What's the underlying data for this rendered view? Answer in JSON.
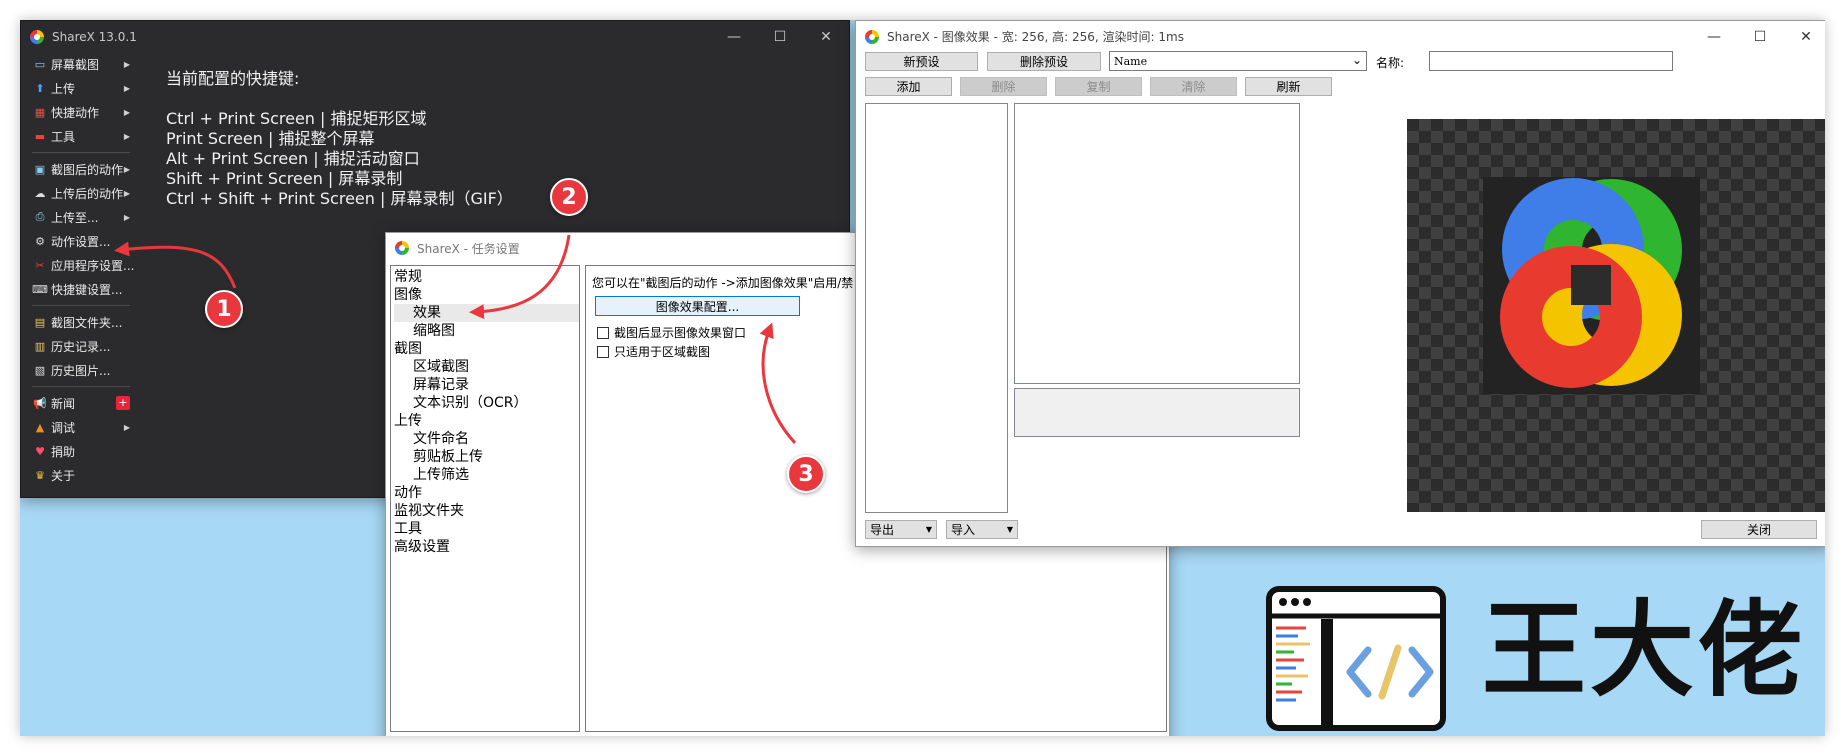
{
  "main_window": {
    "title": "ShareX 13.0.1",
    "menu": [
      {
        "label": "屏幕截图",
        "icon": "monitor-icon",
        "glyph": "▭",
        "color": "#8ecbf0",
        "arrow": true
      },
      {
        "label": "上传",
        "icon": "upload-arrow-icon",
        "glyph": "⬆",
        "color": "#4aa3ff",
        "arrow": true
      },
      {
        "label": "快捷动作",
        "icon": "grid-icon",
        "glyph": "▦",
        "color": "#e0504a",
        "arrow": true
      },
      {
        "label": "工具",
        "icon": "toolbox-icon",
        "glyph": "▬",
        "color": "#e8433c",
        "arrow": true
      },
      {
        "label": "截图后的动作",
        "icon": "image-icon",
        "glyph": "▣",
        "color": "#8ecbf0",
        "arrow": true
      },
      {
        "label": "上传后的动作",
        "icon": "cloud-upload-icon",
        "glyph": "☁",
        "color": "#dddddd",
        "arrow": true
      },
      {
        "label": "上传至...",
        "icon": "printer-icon",
        "glyph": "⎙",
        "color": "#8ecbf0",
        "arrow": true
      },
      {
        "label": "动作设置...",
        "icon": "gear-icon",
        "glyph": "⚙",
        "color": "#dddddd",
        "arrow": false
      },
      {
        "label": "应用程序设置...",
        "icon": "wrench-icon",
        "glyph": "✂",
        "color": "#e8433c",
        "arrow": false
      },
      {
        "label": "快捷键设置...",
        "icon": "keyboard-icon",
        "glyph": "⌨",
        "color": "#dddddd",
        "arrow": false
      },
      {
        "label": "截图文件夹...",
        "icon": "folder-icon",
        "glyph": "▤",
        "color": "#e8c46a",
        "arrow": false
      },
      {
        "label": "历史记录...",
        "icon": "history-icon",
        "glyph": "▥",
        "color": "#e8c46a",
        "arrow": false
      },
      {
        "label": "历史图片...",
        "icon": "image-history-icon",
        "glyph": "▧",
        "color": "#dddddd",
        "arrow": false
      },
      {
        "label": "新闻",
        "icon": "megaphone-icon",
        "glyph": "📢",
        "color": "#dddddd",
        "arrow": false,
        "badge": "+"
      },
      {
        "label": "调试",
        "icon": "traffic-cone-icon",
        "glyph": "▲",
        "color": "#f08a2c",
        "arrow": true
      },
      {
        "label": "捐助",
        "icon": "heart-icon",
        "glyph": "♥",
        "color": "#ff4d6a",
        "arrow": false
      },
      {
        "label": "关于",
        "icon": "crown-icon",
        "glyph": "♛",
        "color": "#f2c14a",
        "arrow": false
      }
    ],
    "hotkeys_title": "当前配置的快捷键:",
    "hotkeys": [
      "Ctrl + Print Screen  |  捕捉矩形区域",
      "Print Screen  |  捕捉整个屏幕",
      "Alt + Print Screen  |  捕捉活动窗口",
      "Shift + Print Screen  |  屏幕录制",
      "Ctrl + Shift + Print Screen  |  屏幕录制（GIF）"
    ]
  },
  "task_window": {
    "title": "ShareX - 任务设置",
    "tree": [
      {
        "label": "常规",
        "level": 1
      },
      {
        "label": "图像",
        "level": 1
      },
      {
        "label": "效果",
        "level": 2,
        "selected": true
      },
      {
        "label": "缩略图",
        "level": 2
      },
      {
        "label": "截图",
        "level": 1
      },
      {
        "label": "区域截图",
        "level": 2
      },
      {
        "label": "屏幕记录",
        "level": 2
      },
      {
        "label": "文本识别（OCR）",
        "level": 2
      },
      {
        "label": "上传",
        "level": 1
      },
      {
        "label": "文件命名",
        "level": 2
      },
      {
        "label": "剪贴板上传",
        "level": 2
      },
      {
        "label": "上传筛选",
        "level": 2
      },
      {
        "label": "动作",
        "level": 1
      },
      {
        "label": "监视文件夹",
        "level": 1
      },
      {
        "label": "工具",
        "level": 1
      },
      {
        "label": "高级设置",
        "level": 1
      }
    ],
    "info_text": "您可以在\"截图后的动作 ->添加图像效果\"启用/禁",
    "effects_button": "图像效果配置...",
    "checkbox_show_window": "截图后显示图像效果窗口",
    "checkbox_region_only": "只适用于区域截图"
  },
  "fx_window": {
    "title": "ShareX - 图像效果 - 宽: 256, 高: 256, 渲染时间: 1ms",
    "new_preset": "新预设",
    "delete_preset": "删除预设",
    "preset_value": "Name",
    "name_label": "名称:",
    "name_value": "",
    "add": "添加",
    "remove": "删除",
    "duplicate": "复制",
    "clear": "清除",
    "refresh": "刷新",
    "export": "导出",
    "import": "导入",
    "close": "关闭"
  },
  "watermark": {
    "text": "王大佬"
  },
  "markers": [
    "1",
    "2",
    "3"
  ],
  "colors": {
    "marker": "#e8383e",
    "dark_window": "#2b2b2d",
    "desktop": "#a7d8f5"
  }
}
